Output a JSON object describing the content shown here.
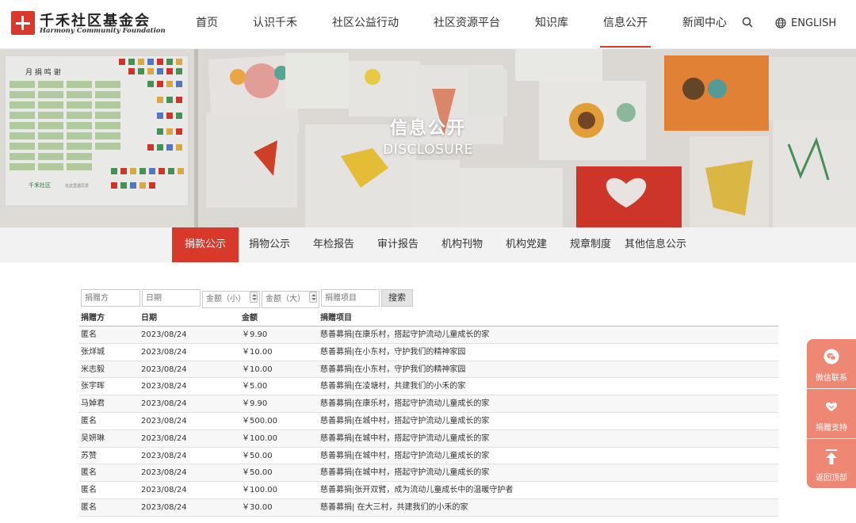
{
  "header": {
    "logo_cn": "千禾社区基金会",
    "logo_en": "Harmony Community Foundation",
    "nav": [
      {
        "label": "首页",
        "active": false
      },
      {
        "label": "认识千禾",
        "active": false
      },
      {
        "label": "社区公益行动",
        "active": false
      },
      {
        "label": "社区资源平台",
        "active": false
      },
      {
        "label": "知识库",
        "active": false
      },
      {
        "label": "信息公开",
        "active": true
      },
      {
        "label": "新闻中心",
        "active": false
      }
    ],
    "search_icon": "search-icon",
    "language": "ENGLISH"
  },
  "banner": {
    "title": "信息公开",
    "subtitle": "DISCLOSURE",
    "photo_text": {
      "board_title": "月 捐 鸣 谢",
      "board_logo": "千禾社区",
      "board_caption": "在这里遇见爱"
    }
  },
  "subnav": [
    {
      "label": "捐款公示",
      "active": true
    },
    {
      "label": "捐物公示",
      "active": false
    },
    {
      "label": "年检报告",
      "active": false
    },
    {
      "label": "审计报告",
      "active": false
    },
    {
      "label": "机构刊物",
      "active": false
    },
    {
      "label": "机构党建",
      "active": false
    },
    {
      "label": "规章制度",
      "active": false
    },
    {
      "label": "其他信息公示",
      "active": false
    }
  ],
  "filters": {
    "donor_placeholder": "捐赠方",
    "date_placeholder": "日期",
    "amount_min_placeholder": "金额（小）",
    "amount_max_placeholder": "金额（大）",
    "project_placeholder": "捐赠项目",
    "search_label": "搜索"
  },
  "table": {
    "headers": [
      "捐赠方",
      "日期",
      "金额",
      "捐赠项目"
    ],
    "rows": [
      [
        "匿名",
        "2023/08/24",
        "￥9.90",
        "慈善募捐|在康乐村，搭起守护流动儿童成长的家"
      ],
      [
        "张烊城",
        "2023/08/24",
        "￥10.00",
        "慈善募捐|在小东村，守护我们的精神家园"
      ],
      [
        "米志毅",
        "2023/08/24",
        "￥10.00",
        "慈善募捐|在小东村，守护我们的精神家园"
      ],
      [
        "张宇晖",
        "2023/08/24",
        "￥5.00",
        "慈善募捐|在凌塘村，共建我们的小禾的家"
      ],
      [
        "马婥君",
        "2023/08/24",
        "￥9.90",
        "慈善募捐|在康乐村，搭起守护流动儿童成长的家"
      ],
      [
        "匿名",
        "2023/08/24",
        "￥500.00",
        "慈善募捐|在城中村，搭起守护流动儿童成长的家"
      ],
      [
        "吴妍琳",
        "2023/08/24",
        "￥100.00",
        "慈善募捐|在城中村，搭起守护流动儿童成长的家"
      ],
      [
        "苏赞",
        "2023/08/24",
        "￥50.00",
        "慈善募捐|在城中村，搭起守护流动儿童成长的家"
      ],
      [
        "匿名",
        "2023/08/24",
        "￥50.00",
        "慈善募捐|在城中村，搭起守护流动儿童成长的家"
      ],
      [
        "匿名",
        "2023/08/24",
        "￥100.00",
        "慈善募捐|张开双臂，成为流动儿童成长中的温暖守护者"
      ],
      [
        "匿名",
        "2023/08/24",
        "￥30.00",
        "慈善募捐| 在大三村，共建我们的小禾的家"
      ]
    ]
  },
  "side_widgets": [
    {
      "label": "微信联系",
      "icon": "wechat-icon"
    },
    {
      "label": "捐赠支持",
      "icon": "heart-hands-icon"
    },
    {
      "label": "返回顶部",
      "icon": "arrow-up-icon"
    }
  ],
  "colors": {
    "accent": "#d9392b",
    "side_widget": "#ef8775",
    "subnav_bg": "#f2f2f2"
  }
}
